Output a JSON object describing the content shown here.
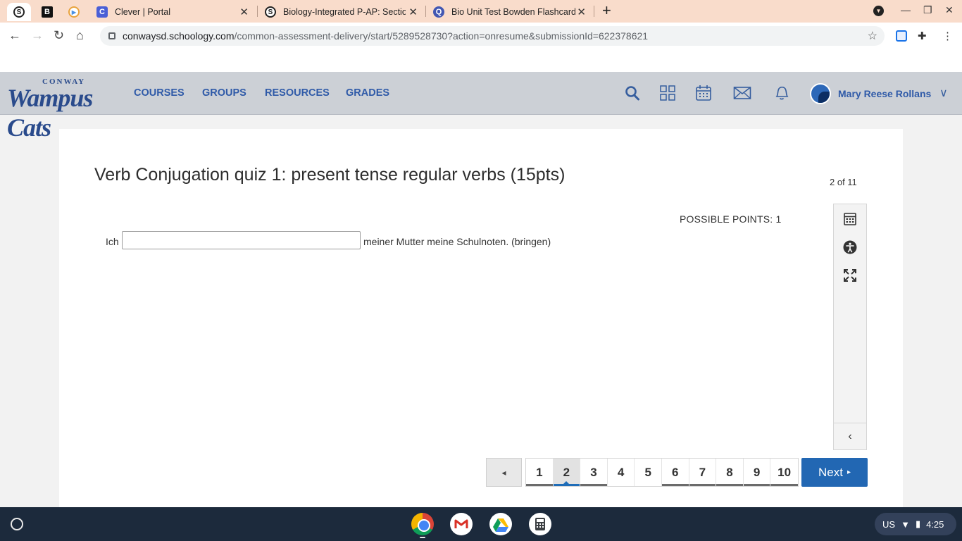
{
  "browser": {
    "tabs": [
      {
        "title": "Clever | Portal"
      },
      {
        "title": "Biology-Integrated P-AP: Section"
      },
      {
        "title": "Bio Unit Test Bowden Flashcards"
      }
    ],
    "url_host": "conwaysd.schoology.com",
    "url_path": "/common-assessment-delivery/start/5289528730?action=onresume&submissionId=622378621"
  },
  "header": {
    "logo_top": "CONWAY",
    "logo_main": "Wampus Cats",
    "nav": [
      "COURSES",
      "GROUPS",
      "RESOURCES",
      "GRADES"
    ],
    "user_name": "Mary Reese Rollans"
  },
  "quiz": {
    "title": "Verb Conjugation quiz 1: present tense regular verbs (15pts)",
    "counter": "2 of 11",
    "possible_points": "POSSIBLE POINTS: 1",
    "prompt_before": "Ich",
    "answer_value": "",
    "prompt_after": "meiner Mutter meine Schulnoten.  (bringen)"
  },
  "pager": {
    "prev_symbol": "◂",
    "pages": [
      "1",
      "2",
      "3",
      "4",
      "5",
      "6",
      "7",
      "8",
      "9",
      "10"
    ],
    "current_page": "2",
    "next_label": "Next",
    "next_symbol": "▸"
  },
  "shelf": {
    "locale": "US",
    "time": "4:25"
  },
  "colors": {
    "header_bg": "#ccd0d6",
    "nav_text": "#2f5aa8",
    "next_button": "#2267b3",
    "tabstrip": "#f9dccb",
    "shelf": "#1c2a3c"
  }
}
